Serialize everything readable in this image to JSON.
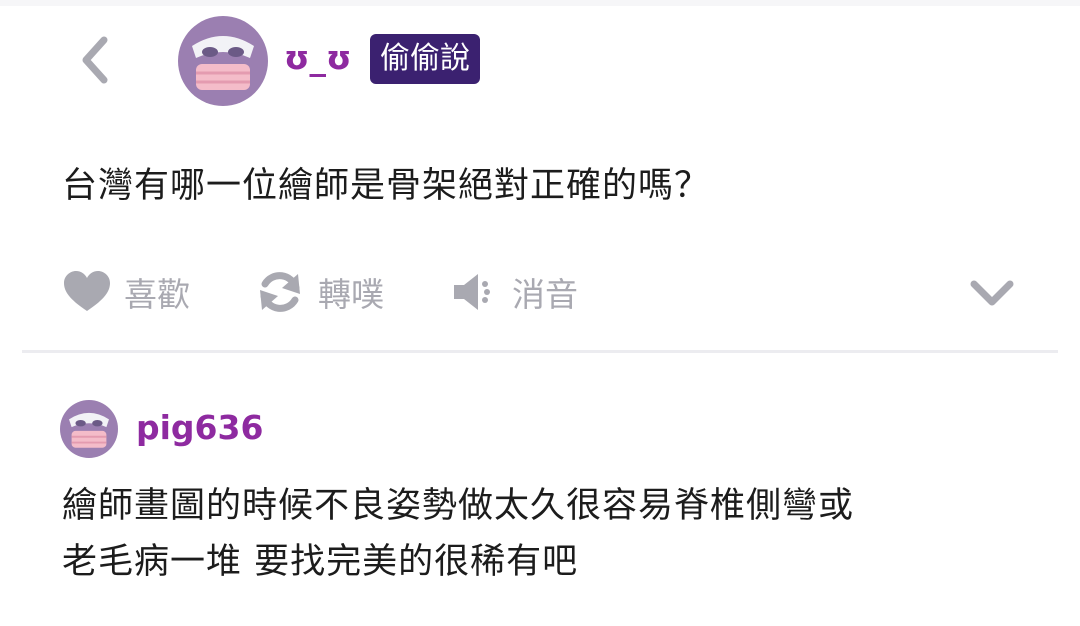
{
  "post": {
    "author": "ʊ_ʊ",
    "badge": "偷偷說",
    "title": "台灣有哪一位繪師是骨架絕對正確的嗎？",
    "actions": {
      "like": "喜歡",
      "repost": "轉噗",
      "mute": "消音"
    }
  },
  "comment": {
    "author": "pig636",
    "lines": [
      "繪師畫圖的時候不良姿勢做太久很容易脊椎側彎或",
      "老毛病一堆 要找完美的很稀有吧"
    ]
  },
  "icons": {
    "back": "chevron-left-icon",
    "like": "heart-icon",
    "repost": "refresh-icon",
    "mute": "speaker-mute-icon",
    "expand": "chevron-down-icon",
    "avatar": "masked-avatar"
  },
  "colors": {
    "accent": "#8e2aa0",
    "badge_bg": "#3b2170",
    "icon_gray": "#a9a9b1",
    "avatar_bg": "#9b7fb1"
  }
}
